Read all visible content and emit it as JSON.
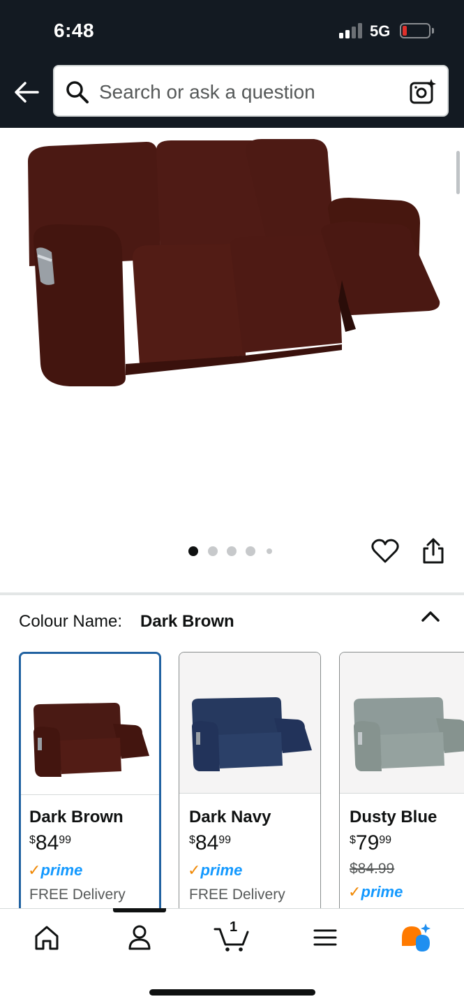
{
  "status_bar": {
    "time": "6:48",
    "network": "5G"
  },
  "search": {
    "placeholder": "Search or ask a question"
  },
  "product_image": {
    "carousel_dots": 5,
    "active_index": 0
  },
  "variation": {
    "label": "Colour Name:",
    "selected_value": "Dark Brown",
    "options": [
      {
        "name": "Dark Brown",
        "price_symbol": "$",
        "price_whole": "84",
        "price_fraction": "99",
        "prime_label": "prime",
        "delivery": "FREE Delivery",
        "color": "#4a1a14",
        "selected": true
      },
      {
        "name": "Dark Navy",
        "price_symbol": "$",
        "price_whole": "84",
        "price_fraction": "99",
        "prime_label": "prime",
        "delivery": "FREE Delivery",
        "color": "#233760",
        "selected": false
      },
      {
        "name": "Dusty Blue",
        "price_symbol": "$",
        "price_whole": "79",
        "price_fraction": "99",
        "list_price": "$84.99",
        "prime_label": "prime",
        "color": "#8d9a98",
        "selected": false
      }
    ]
  },
  "bottom_nav": {
    "items": [
      "home-icon",
      "account-icon",
      "cart-icon",
      "menu-icon",
      "rufus-ai-icon"
    ],
    "cart_count": "1",
    "active": "account-icon"
  },
  "colors": {
    "header_bg": "#131a22",
    "selected_border": "#2162a1",
    "prime_blue": "#1399ff",
    "prime_check": "#f08804",
    "sofa_brown": "#4a1a14"
  }
}
